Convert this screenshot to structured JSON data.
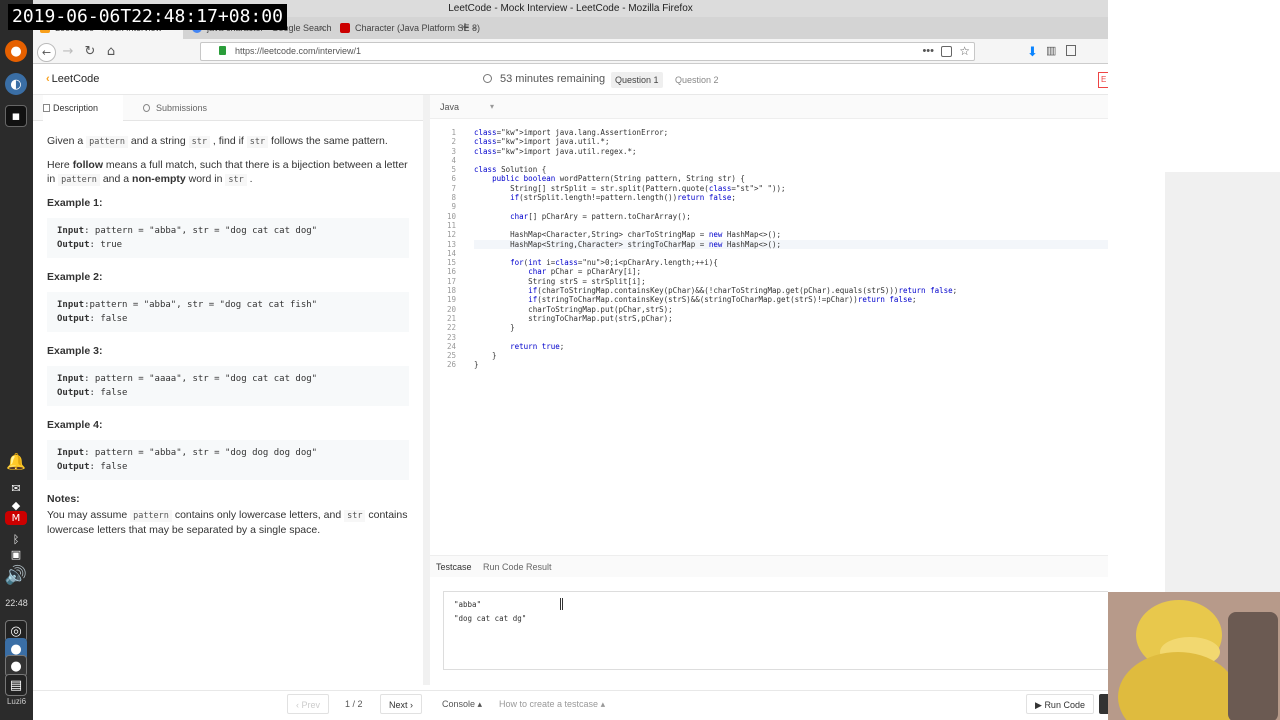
{
  "overlay": {
    "timestamp": "2019-06-06T22:48:17+08:00"
  },
  "taskbar": {
    "clock": "22:48",
    "user": "Luzi6"
  },
  "window": {
    "title": "LeetCode - Mock Interview - LeetCode - Mozilla Firefox"
  },
  "tabs": [
    {
      "label": "LeetCode - Mock Interview",
      "close": "×"
    },
    {
      "label": "java character - Google Search",
      "close": "×"
    },
    {
      "label": "Character (Java Platform SE 8)",
      "close": "×"
    }
  ],
  "newtab": "+",
  "browser": {
    "url": "https://leetcode.com/interview/1",
    "dots": "•••",
    "star": "☆",
    "back": "←",
    "forward": "→",
    "reload": "↻",
    "home": "⌂"
  },
  "header": {
    "logo": "LeetCode",
    "timer": "53 minutes remaining",
    "q1": "Question 1",
    "q2": "Question 2",
    "end": "E"
  },
  "left_tabs": {
    "description": "Description",
    "submissions": "Submissions"
  },
  "problem": {
    "p1a": "Given a ",
    "p1b": "pattern",
    "p1c": " and a string ",
    "p1d": "str",
    "p1e": " , find if ",
    "p1f": "str",
    "p1g": " follows the same pattern.",
    "p2a": "Here ",
    "p2b": "follow",
    "p2c": " means a full match, such that there is a bijection between a letter in ",
    "p2d": "pattern",
    "p2e": " and a ",
    "p2f": "non-empty",
    "p2g": " word in ",
    "p2h": "str",
    "p2i": " .",
    "examples": [
      {
        "title": "Example 1:",
        "input_label": "Input",
        "input": ": pattern = \"abba\", str = \"dog cat cat dog\"",
        "output_label": "Output",
        "output": ": true"
      },
      {
        "title": "Example 2:",
        "input_label": "Input",
        "input": ":pattern = \"abba\", str = \"dog cat cat fish\"",
        "output_label": "Output",
        "output": ": false"
      },
      {
        "title": "Example 3:",
        "input_label": "Input",
        "input": ": pattern = \"aaaa\", str = \"dog cat cat dog\"",
        "output_label": "Output",
        "output": ": false"
      },
      {
        "title": "Example 4:",
        "input_label": "Input",
        "input": ": pattern = \"abba\", str = \"dog dog dog dog\"",
        "output_label": "Output",
        "output": ": false"
      }
    ],
    "notes_title": "Notes:",
    "n1": "You may assume ",
    "n2": "pattern",
    "n3": " contains only lowercase letters, and ",
    "n4": "str",
    "n5": " contains lowercase letters that may be separated by a single space."
  },
  "editor": {
    "language": "Java",
    "code": [
      "import java.lang.AssertionError;",
      "import java.util.*;",
      "import java.util.regex.*;",
      "",
      "class Solution {",
      "    public boolean wordPattern(String pattern, String str) {",
      "        String[] strSplit = str.split(Pattern.quote(\" \"));",
      "        if(strSplit.length!=pattern.length())return false;",
      "",
      "        char[] pCharAry = pattern.toCharArray();",
      "",
      "        HashMap<Character,String> charToStringMap = new HashMap<>();",
      "        HashMap<String,Character> stringToCharMap = new HashMap<>();",
      "",
      "        for(int i=0;i<pCharAry.length;++i){",
      "            char pChar = pCharAry[i];",
      "            String strS = strSplit[i];",
      "            if(charToStringMap.containsKey(pChar)&&(!charToStringMap.get(pChar).equals(strS)))return false;",
      "            if(stringToCharMap.containsKey(strS)&&(stringToCharMap.get(strS)!=pChar))return false;",
      "            charToStringMap.put(pChar,strS);",
      "            stringToCharMap.put(strS,pChar);",
      "        }",
      "",
      "        return true;",
      "    }",
      "}"
    ]
  },
  "testcase": {
    "tab_testcase": "Testcase",
    "tab_result": "Run Code Result",
    "line1": "\"abba\"",
    "line2": "\"dog cat cat dg\""
  },
  "footer": {
    "prev": "‹ Prev",
    "page": "1 / 2",
    "next": "Next ›",
    "console": "Console",
    "howto": "How to create a testcase",
    "run": "Run Code"
  }
}
